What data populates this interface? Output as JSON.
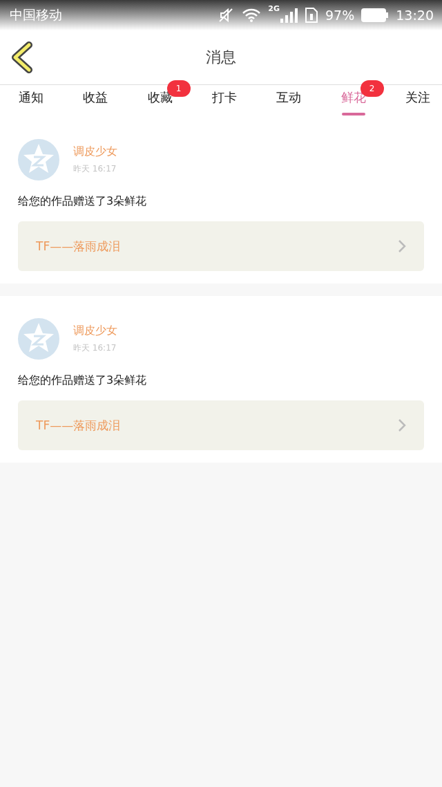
{
  "status_bar": {
    "carrier": "中国移动",
    "network": "2G",
    "battery": "97%",
    "time": "13:20"
  },
  "header": {
    "title": "消息"
  },
  "tabs": [
    {
      "label": "通知",
      "selected": false
    },
    {
      "label": "收益",
      "selected": false
    },
    {
      "label": "收藏",
      "selected": false,
      "badge": "1"
    },
    {
      "label": "打卡",
      "selected": false
    },
    {
      "label": "互动",
      "selected": false
    },
    {
      "label": "鲜花",
      "selected": true,
      "badge": "2"
    },
    {
      "label": "关注",
      "selected": false
    }
  ],
  "messages": [
    {
      "user": "调皮少女",
      "time": "昨天 16:17",
      "text": "给您的作品赠送了3朵鲜花",
      "work": "TF——落雨成泪"
    },
    {
      "user": "调皮少女",
      "time": "昨天 16:17",
      "text": "给您的作品赠送了3朵鲜花",
      "work": "TF——落雨成泪"
    }
  ]
}
